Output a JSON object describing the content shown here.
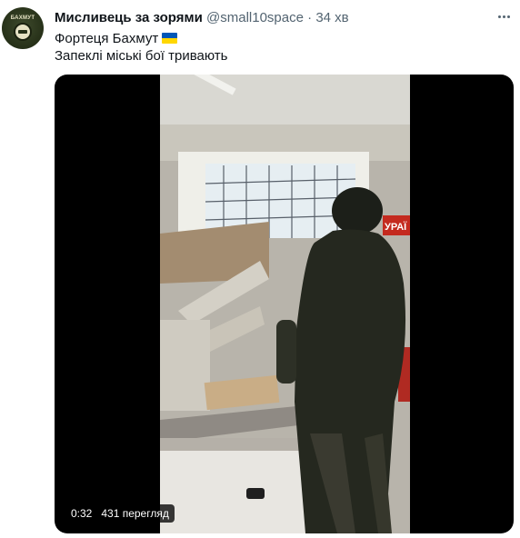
{
  "author": {
    "display_name": "Мисливець за зорями",
    "handle": "@small10space",
    "separator": "·",
    "time_ago": "34 хв",
    "avatar_text": "БАХМУТ"
  },
  "tweet": {
    "line1": "Фортеця Бахмут",
    "line2": "Запеклі міські бої тривають",
    "flag_icon": "ukraine-flag-icon"
  },
  "video": {
    "elapsed": "0:32",
    "views": "431 перегляд",
    "sign_text": "УРАЇ"
  },
  "colors": {
    "primary_text": "#0f1419",
    "secondary_text": "#536471",
    "flag_blue": "#0057b7",
    "flag_yellow": "#ffd700"
  }
}
